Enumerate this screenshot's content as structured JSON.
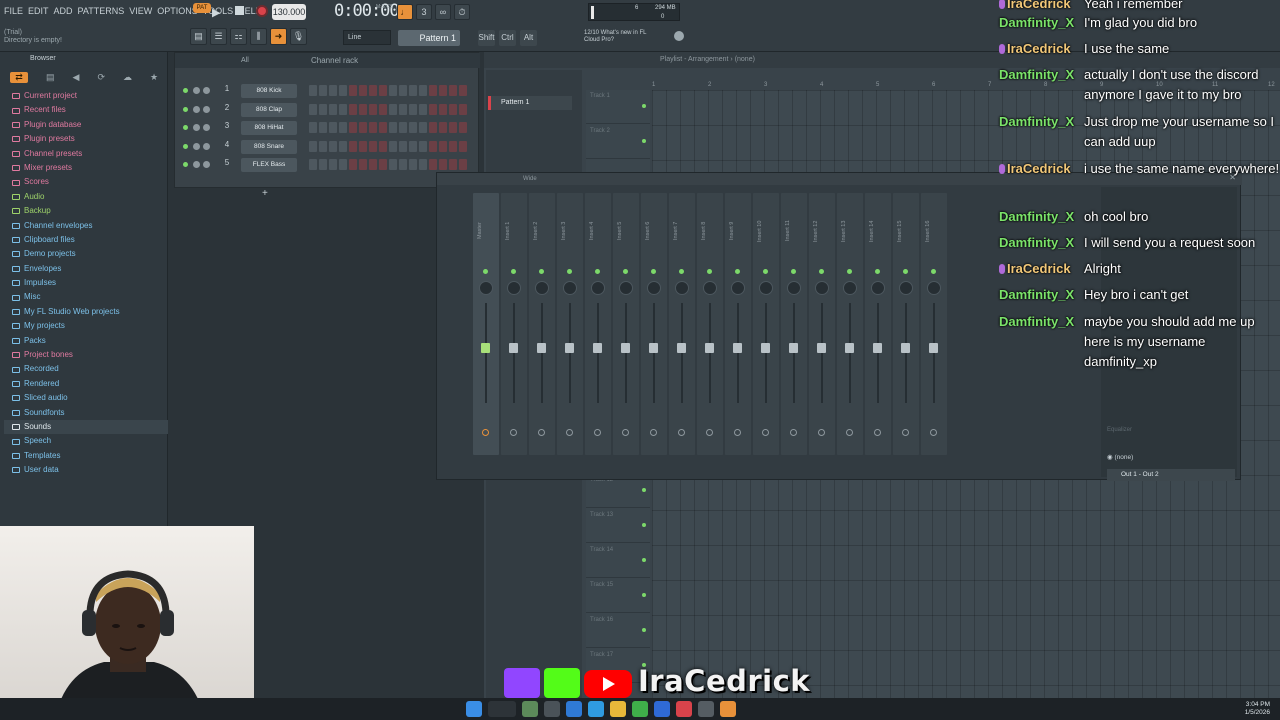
{
  "menu": [
    "File",
    "Edit",
    "Add",
    "Patterns",
    "View",
    "Options",
    "Tools",
    "Help"
  ],
  "status": {
    "trial": "(Trial)",
    "hint": "Directory is empty!"
  },
  "transport": {
    "pattern_badge": "PAT",
    "tempo": "130.000",
    "time": "0:00:00",
    "time_unit": "M:S:CS"
  },
  "cpu": {
    "memory": "294 MB",
    "cpu": "6",
    "polyphony": "0"
  },
  "toolbar": {
    "snap": "Line",
    "pattern": "Pattern 1",
    "modes": [
      "Shift",
      "Ctrl",
      "Alt"
    ]
  },
  "news": {
    "line1": "12/10  What's new in FL",
    "line2": "Cloud Pro?"
  },
  "browser": {
    "title": "Browser",
    "filter": "All",
    "items": [
      {
        "label": "Current project",
        "color": "pink"
      },
      {
        "label": "Recent files",
        "color": "pink"
      },
      {
        "label": "Plugin database",
        "color": "pink"
      },
      {
        "label": "Plugin presets",
        "color": "pink"
      },
      {
        "label": "Channel presets",
        "color": "pink"
      },
      {
        "label": "Mixer presets",
        "color": "pink"
      },
      {
        "label": "Scores",
        "color": "pink"
      },
      {
        "label": "Audio",
        "color": "green"
      },
      {
        "label": "Backup",
        "color": "green"
      },
      {
        "label": "Channel envelopes",
        "color": "blue"
      },
      {
        "label": "Clipboard files",
        "color": "blue"
      },
      {
        "label": "Demo projects",
        "color": "blue"
      },
      {
        "label": "Envelopes",
        "color": "blue"
      },
      {
        "label": "Impulses",
        "color": "blue"
      },
      {
        "label": "Misc",
        "color": "blue"
      },
      {
        "label": "My FL Studio Web projects",
        "color": "blue"
      },
      {
        "label": "My projects",
        "color": "blue"
      },
      {
        "label": "Packs",
        "color": "blue"
      },
      {
        "label": "Project bones",
        "color": "pink"
      },
      {
        "label": "Recorded",
        "color": "blue"
      },
      {
        "label": "Rendered",
        "color": "blue"
      },
      {
        "label": "Sliced audio",
        "color": "blue"
      },
      {
        "label": "Soundfonts",
        "color": "blue"
      },
      {
        "label": "Sounds",
        "color": "blue"
      },
      {
        "label": "Speech",
        "color": "blue"
      },
      {
        "label": "Templates",
        "color": "blue"
      },
      {
        "label": "User data",
        "color": "blue"
      }
    ]
  },
  "channel_rack": {
    "title": "Channel rack",
    "filter": "All",
    "channels": [
      {
        "num": "1",
        "name": "808 Kick"
      },
      {
        "num": "2",
        "name": "808 Clap"
      },
      {
        "num": "3",
        "name": "808 HiHat"
      },
      {
        "num": "4",
        "name": "808 Snare"
      },
      {
        "num": "5",
        "name": "FLEX Bass"
      }
    ]
  },
  "playlist": {
    "title": "Playlist - Arrangement › (none)",
    "pattern": "Pattern 1",
    "tracks": [
      "Track 1",
      "Track 2",
      "Track 12",
      "Track 13",
      "Track 14",
      "Track 15",
      "Track 16",
      "Track 17"
    ],
    "ruler": [
      "1",
      "2",
      "3",
      "4",
      "5",
      "6",
      "7",
      "8",
      "9",
      "10",
      "11",
      "12"
    ]
  },
  "mixer": {
    "mode": "Wide",
    "master": "Master",
    "inserts": [
      "Insert 1",
      "Insert 2",
      "Insert 3",
      "Insert 4",
      "Insert 5",
      "Insert 6",
      "Insert 7",
      "Insert 8",
      "Insert 9",
      "Insert 10",
      "Insert 11",
      "Insert 12",
      "Insert 13",
      "Insert 14",
      "Insert 15",
      "Insert 16"
    ],
    "eq": "Equalizer",
    "input": "(none)",
    "output": "Out 1 - Out 2"
  },
  "chat": [
    {
      "user": "IraCedrick",
      "text": "Yeah i remember",
      "color": "orange",
      "badge": true
    },
    {
      "user": "Damfinity_X",
      "text": "I'm glad you did bro",
      "color": "green",
      "badge": false
    },
    {
      "user": "IraCedrick",
      "text": "I use the same",
      "color": "orange",
      "badge": true
    },
    {
      "user": "Damfinity_X",
      "text": "actually I don't use the discord anymore I gave it to my bro",
      "color": "green",
      "badge": false
    },
    {
      "user": "Damfinity_X",
      "text": "Just drop me your username so I can add uup",
      "color": "green",
      "badge": false
    },
    {
      "user": "IraCedrick",
      "text": "i use the same name everywhere!",
      "color": "orange",
      "badge": true
    },
    {
      "user": "Damfinity_X",
      "text": "oh cool bro",
      "color": "green",
      "badge": false
    },
    {
      "user": "Damfinity_X",
      "text": "I will send you a request soon",
      "color": "green",
      "badge": false
    },
    {
      "user": "IraCedrick",
      "text": "Alright",
      "color": "orange",
      "badge": true
    },
    {
      "user": "Damfinity_X",
      "text": "Hey bro i can't get",
      "color": "green",
      "badge": false
    },
    {
      "user": "Damfinity_X",
      "text": "maybe you should add me up here is my username damfinity_xp",
      "color": "green",
      "badge": false
    }
  ],
  "brand": {
    "name": "IraCedrick",
    "icons": [
      "twitch-icon",
      "kick-icon",
      "youtube-icon"
    ]
  },
  "taskbar": {
    "search": "Search",
    "time": "3:04 PM",
    "date": "1/5/2026"
  }
}
